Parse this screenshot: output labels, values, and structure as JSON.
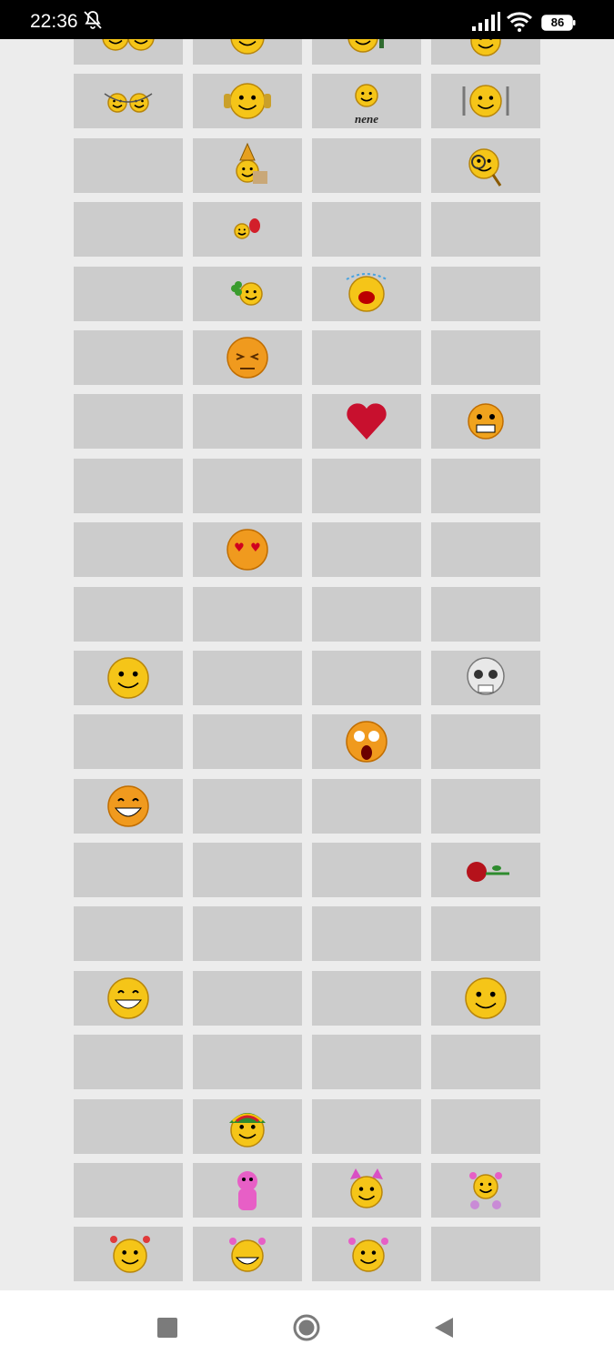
{
  "status_bar": {
    "time": "22:36",
    "battery_level": "86",
    "icons": [
      "bell-off-icon",
      "signal-icon",
      "wifi-icon",
      "battery-icon"
    ]
  },
  "emoticon_grid": {
    "columns": 4,
    "cells": [
      "smiley-pair",
      "smiley",
      "smiley-with-pipe",
      "smiley-halo",
      "smiley-chain",
      "smiley-headphones",
      "smiley-nene",
      "smiley-fork-knife",
      "",
      "smiley-bishop",
      "",
      "smiley-magnifier",
      "",
      "smiley-balloon",
      "",
      "",
      "",
      "smiley-clover",
      "smiley-crying",
      "",
      "",
      "smiley-squint",
      "",
      "",
      "",
      "",
      "heart",
      "smiley-evil-grin",
      "",
      "",
      "",
      "",
      "",
      "smiley-heart-eyes",
      "",
      "",
      "",
      "",
      "",
      "",
      "smiley-big",
      "",
      "",
      "smiley-skull",
      "",
      "",
      "smiley-shocked",
      "",
      "smiley-grin",
      "",
      "",
      "",
      "",
      "",
      "",
      "rose",
      "",
      "",
      "",
      "",
      "smiley-laugh",
      "",
      "",
      "smiley-content",
      "",
      "",
      "",
      "",
      "",
      "smiley-rasta",
      "",
      "",
      "",
      "pink-bear",
      "smiley-cat-bow",
      "smiley-girl-flower",
      "smiley-girl-wave",
      "smiley-girl-laugh",
      "smiley-girl-think",
      ""
    ],
    "colors": {
      "cell": "#cccccc",
      "background": "#ececec",
      "emoticon_yellow": "#f5c518",
      "heart_red": "#c8102e"
    },
    "caption_nene": "nene"
  },
  "nav_bar": {
    "buttons": [
      "recent-apps-button",
      "home-button",
      "back-button"
    ]
  }
}
